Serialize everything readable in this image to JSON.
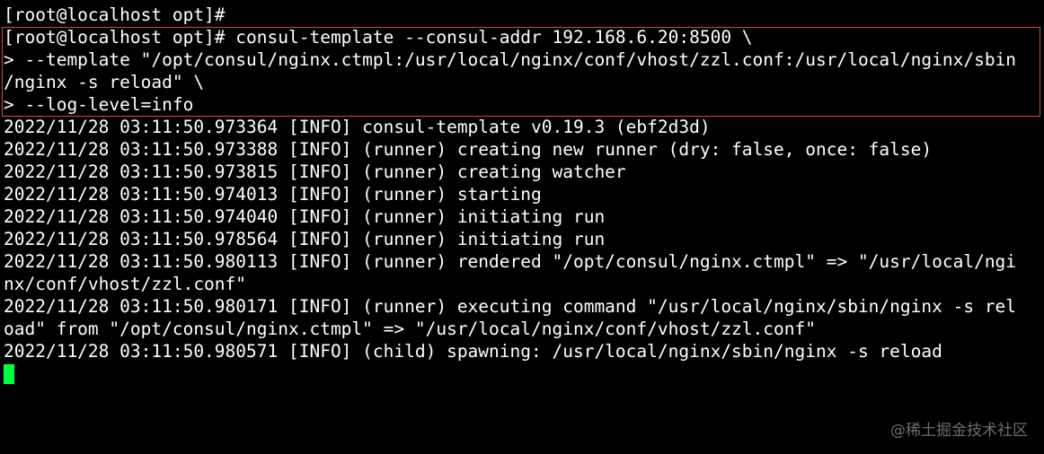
{
  "terminal": {
    "lines": [
      "[root@localhost opt]#",
      "[root@localhost opt]# consul-template --consul-addr 192.168.6.20:8500 \\",
      "> --template \"/opt/consul/nginx.ctmpl:/usr/local/nginx/conf/vhost/zzl.conf:/usr/local/nginx/sbin",
      "/nginx -s reload\" \\",
      "> --log-level=info",
      "2022/11/28 03:11:50.973364 [INFO] consul-template v0.19.3 (ebf2d3d)",
      "2022/11/28 03:11:50.973388 [INFO] (runner) creating new runner (dry: false, once: false)",
      "2022/11/28 03:11:50.973815 [INFO] (runner) creating watcher",
      "2022/11/28 03:11:50.974013 [INFO] (runner) starting",
      "2022/11/28 03:11:50.974040 [INFO] (runner) initiating run",
      "2022/11/28 03:11:50.978564 [INFO] (runner) initiating run",
      "2022/11/28 03:11:50.980113 [INFO] (runner) rendered \"/opt/consul/nginx.ctmpl\" => \"/usr/local/ngi",
      "nx/conf/vhost/zzl.conf\"",
      "2022/11/28 03:11:50.980171 [INFO] (runner) executing command \"/usr/local/nginx/sbin/nginx -s rel",
      "oad\" from \"/opt/consul/nginx.ctmpl\" => \"/usr/local/nginx/conf/vhost/zzl.conf\"",
      "2022/11/28 03:11:50.980571 [INFO] (child) spawning: /usr/local/nginx/sbin/nginx -s reload"
    ],
    "cursor_color": "#00ff3c",
    "highlight_color": "#e0453a"
  },
  "watermark": {
    "text": "@稀土掘金技术社区"
  }
}
